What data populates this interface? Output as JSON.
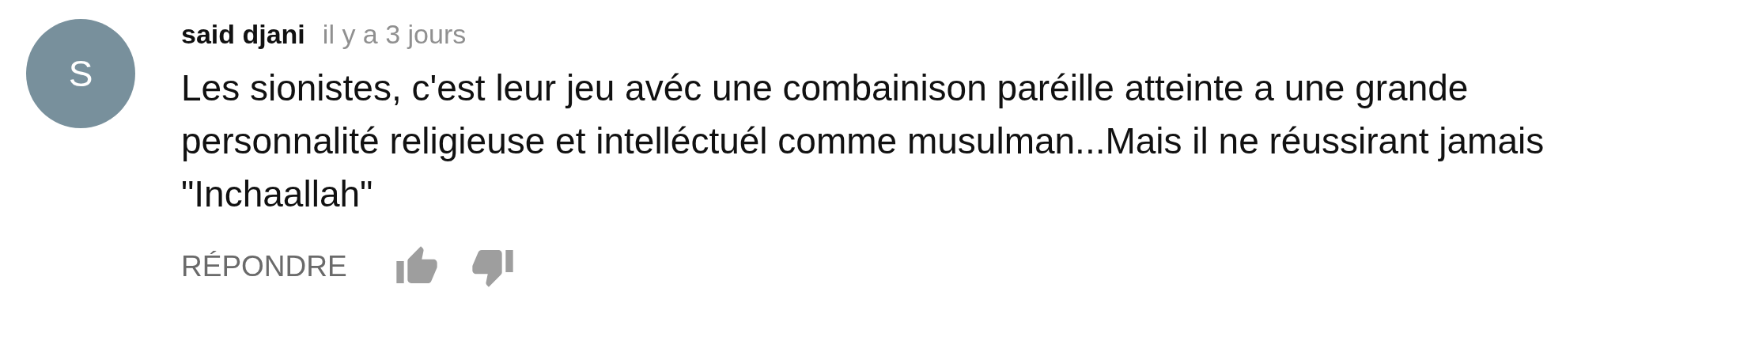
{
  "comment": {
    "avatar_letter": "S",
    "author": "said djani",
    "time": "il y a 3 jours",
    "text": "Les sionistes, c'est leur jeu avéc une combainison paréille atteinte a une grande personnalité religieuse et intelléctuél comme musulman...Mais il ne réussirant jamais \"Inchaallah\"",
    "reply_label": "RÉPONDRE",
    "liked": false,
    "disliked": false
  }
}
